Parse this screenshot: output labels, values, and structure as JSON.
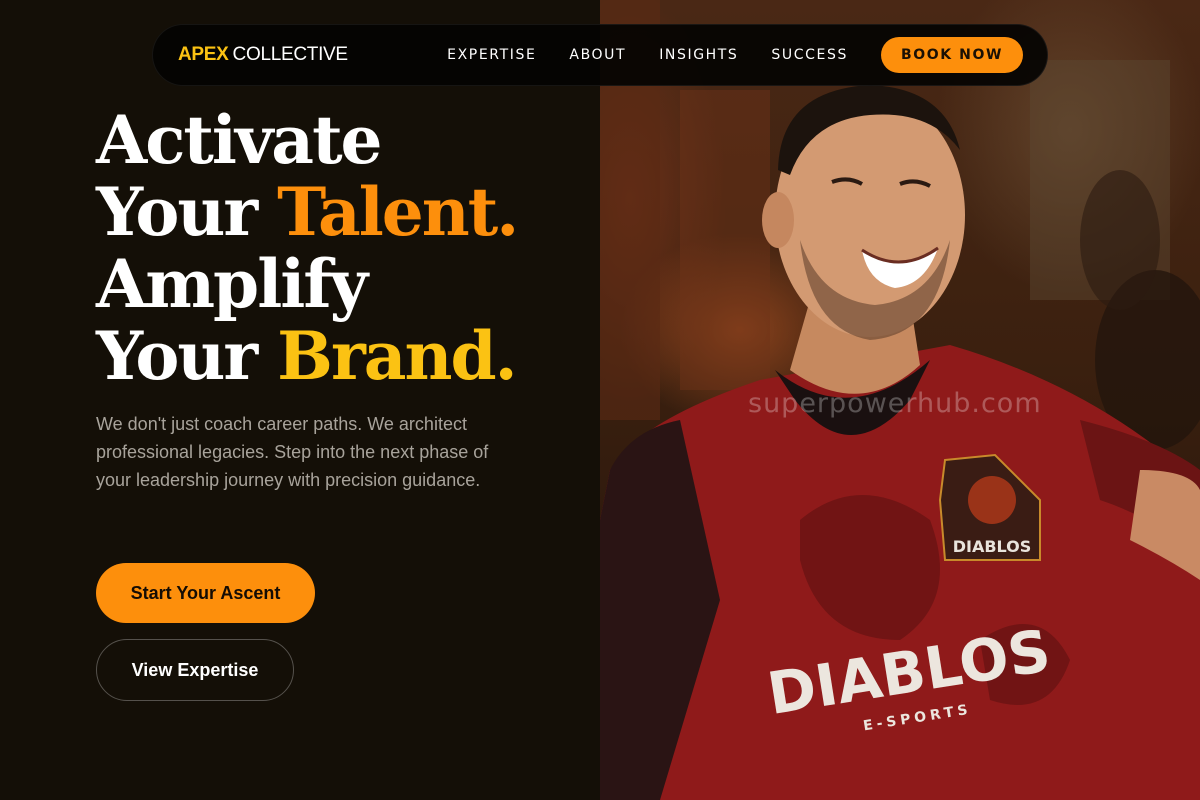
{
  "brand": {
    "name_highlight": "APEX",
    "name_rest": "COLLECTIVE",
    "highlight_color": "#fbc213"
  },
  "nav": {
    "links": [
      "EXPERTISE",
      "ABOUT",
      "INSIGHTS",
      "SUCCESS"
    ],
    "cta_label": "BOOK NOW"
  },
  "hero": {
    "line1": "Activate",
    "line2_plain": "Your",
    "line2_accent": "Talent.",
    "line3": "Amplify",
    "line4_plain": "Your",
    "line4_accent": "Brand.",
    "subtitle": "We don't just coach career paths. We architect professional legacies. Step into the next phase of your leadership journey with precision guidance.",
    "primary_cta": "Start Your Ascent",
    "secondary_cta": "View Expertise"
  },
  "photo": {
    "jersey_text": "DIABLOS",
    "jersey_subtext": "E-SPORTS",
    "watermark": "superpowerhub.com"
  },
  "colors": {
    "accent_orange": "#fd8f0c",
    "accent_yellow": "#fbc213",
    "background": "#140f07",
    "body_text": "#a8a39b"
  }
}
